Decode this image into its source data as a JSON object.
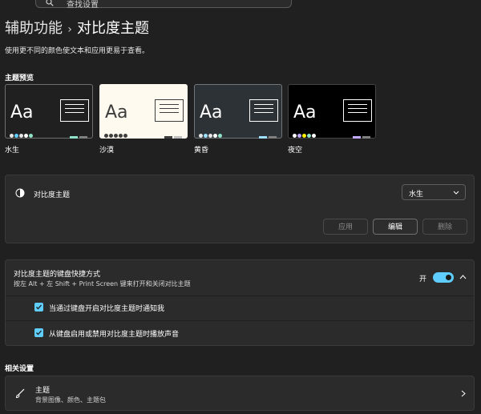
{
  "search": {
    "placeholder": "查找设置"
  },
  "breadcrumb": {
    "parent": "辅助功能",
    "separator": "›",
    "current": "对比度主题"
  },
  "description": "使用更不同的颜色使文本和应用更易于查看。",
  "preview_label": "主题预览",
  "themes": [
    {
      "name": "水生",
      "aa": "Aa",
      "bg": "#202020",
      "fg": "#ffffff",
      "border": "#6f6f6f",
      "dots": [
        "#e6e6e6",
        "#60cdff",
        "#e6e6e6",
        "#ffffff",
        "#8ee3c8"
      ],
      "btn1": "#8ee3c8",
      "btn2": "#808080"
    },
    {
      "name": "沙漠",
      "aa": "Aa",
      "bg": "#fffaef",
      "fg": "#3d3d3d",
      "border": "#fffaef",
      "dots": [
        "#3d3d3d",
        "#3d3d3d",
        "#3d3d3d",
        "#3d3d3d",
        "#3d3d3d"
      ],
      "btn1": "#3d3d3d",
      "btn2": "#bfbfbf"
    },
    {
      "name": "黄昏",
      "aa": "Aa",
      "bg": "#2d3236",
      "fg": "#ffffff",
      "border": "#6f7579",
      "dots": [
        "#e6e6e6",
        "#a0e0ff",
        "#e6e6e6",
        "#ffffff",
        "#8ee3c8"
      ],
      "btn1": "#a0e0ff",
      "btn2": "#808080"
    },
    {
      "name": "夜空",
      "aa": "Aa",
      "bg": "#000000",
      "fg": "#ffffff",
      "border": "#444444",
      "dots": [
        "#ffffff",
        "#c0a9ff",
        "#fff200",
        "#8ee3c8",
        "#ffffff"
      ],
      "btn1": "#c0a9ff",
      "btn2": "#808080"
    }
  ],
  "contrast_panel": {
    "label": "对比度主题",
    "selected_theme": "水生",
    "apply": "应用",
    "edit": "编辑",
    "delete": "删除"
  },
  "shortcut_panel": {
    "title": "对比度主题的键盘快捷方式",
    "subtitle": "按左 Alt + 左 Shift + Print Screen 键来打开和关闭对比主题",
    "toggle_state": "开",
    "toggle_on": true,
    "options": [
      {
        "label": "当通过键盘开启对比度主题时通知我",
        "checked": true
      },
      {
        "label": "从键盘启用或禁用对比度主题时播放声音",
        "checked": true
      }
    ]
  },
  "related_label": "相关设置",
  "related": {
    "title": "主题",
    "subtitle": "背景图像、颜色、主题包"
  },
  "colors": {
    "accent": "#60cdff",
    "background": "#202020",
    "card": "#2b2b2b"
  }
}
